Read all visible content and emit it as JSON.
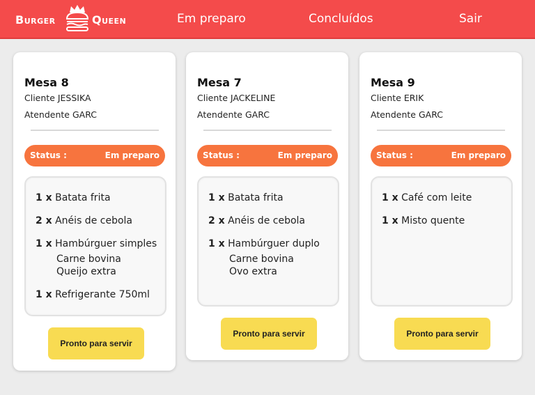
{
  "brand": {
    "left": "Burger",
    "right": "Queen",
    "accent": "#f44b4b"
  },
  "nav": {
    "preparo": "Em preparo",
    "concluidos": "Concluídos",
    "sair": "Sair"
  },
  "orders": [
    {
      "mesa": "Mesa 8",
      "cliente": "Cliente JESSIKA",
      "atendente": "Atendente GARC",
      "status_label": "Status :",
      "status_value": "Em preparo",
      "items": [
        {
          "qty": "1 x",
          "name": "Batata frita"
        },
        {
          "qty": "2 x",
          "name": "Anéis de cebola"
        },
        {
          "qty": "1 x",
          "name": "Hambúrguer simples",
          "extras": [
            "Carne bovina",
            "Queijo extra"
          ]
        },
        {
          "qty": "1 x",
          "name": "Refrigerante 750ml"
        }
      ],
      "button": "Pronto para servir"
    },
    {
      "mesa": "Mesa 7",
      "cliente": "Cliente JACKELINE",
      "atendente": "Atendente GARC",
      "status_label": "Status :",
      "status_value": "Em preparo",
      "items": [
        {
          "qty": "1 x",
          "name": "Batata frita"
        },
        {
          "qty": "2 x",
          "name": "Anéis de cebola"
        },
        {
          "qty": "1 x",
          "name": "Hambúrguer duplo",
          "extras": [
            "Carne bovina",
            "Ovo extra"
          ]
        }
      ],
      "button": "Pronto para servir"
    },
    {
      "mesa": "Mesa 9",
      "cliente": "Cliente ERIK",
      "atendente": "Atendente GARC",
      "status_label": "Status :",
      "status_value": "Em preparo",
      "items": [
        {
          "qty": "1 x",
          "name": "Café com leite"
        },
        {
          "qty": "1 x",
          "name": "Misto quente"
        }
      ],
      "button": "Pronto para servir"
    }
  ]
}
